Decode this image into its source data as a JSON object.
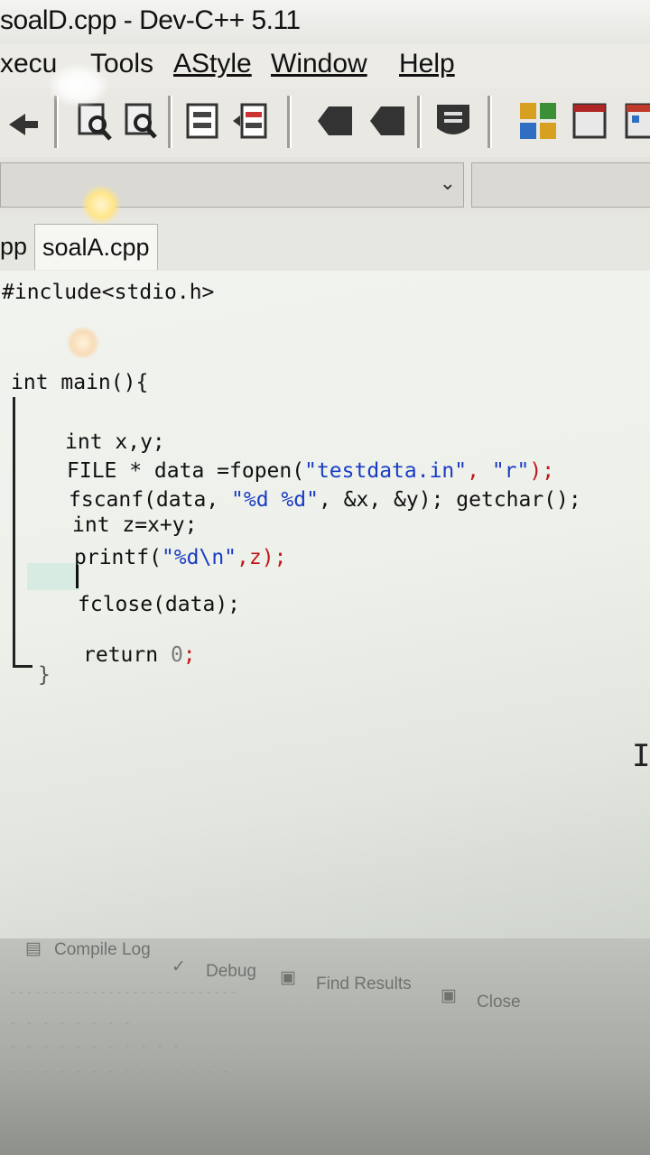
{
  "window": {
    "title": "soalD.cpp - Dev-C++ 5.11"
  },
  "menu": {
    "items": [
      "xecu",
      "Tools",
      "AStyle",
      "Window",
      "Help"
    ]
  },
  "tabs": [
    {
      "label": "pp"
    },
    {
      "label": "soalA.cpp"
    }
  ],
  "code": {
    "line1": "#include<stdio.h>",
    "line2": "int main(){",
    "line3": "int x,y;",
    "line4_a": "FILE * data =fopen(",
    "line4_b": "\"testdata.in\"",
    "line4_c": ", ",
    "line4_d": "\"r\"",
    "line4_e": ");",
    "line5_a": "fscanf(data, ",
    "line5_b": "\"%d %d\"",
    "line5_c": ", &x, &y); getchar();",
    "line6": "int z=x+y;",
    "line7_a": "printf(",
    "line7_b": "\"%d\\n\"",
    "line7_c": ",z);",
    "line8": "fclose(data);",
    "line9_a": "return ",
    "line9_b": "0",
    "line9_c": ";",
    "line10": "}"
  },
  "bottom_panel": {
    "tabs": [
      "Compile Log",
      "Debug",
      "Find Results",
      "Close"
    ]
  },
  "colors": {
    "keyword_text": "#111111",
    "string": "#1a3cc4",
    "punct": "#c0161d",
    "number": "#7a7a7a"
  }
}
